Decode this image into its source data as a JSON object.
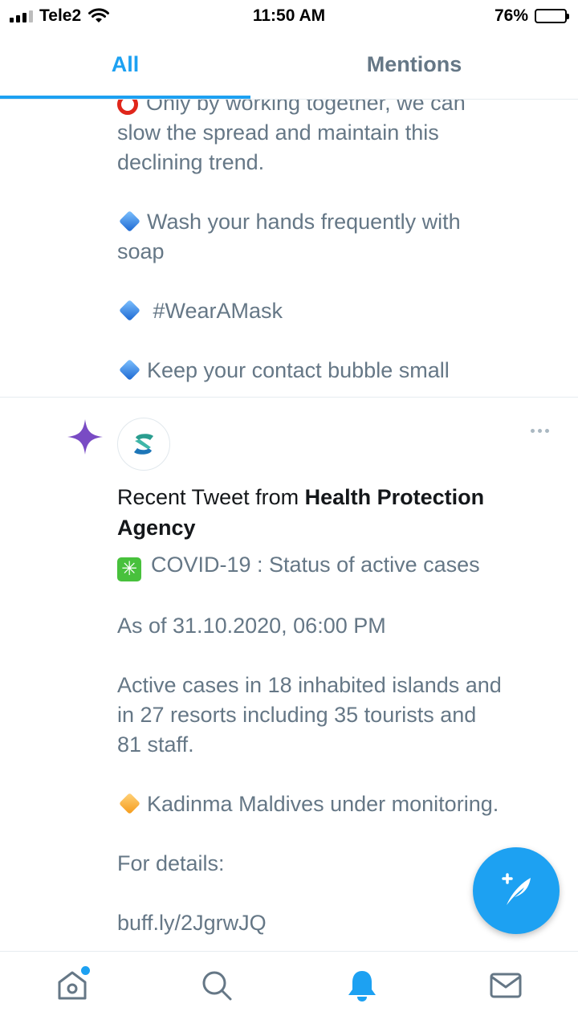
{
  "status_bar": {
    "carrier": "Tele2",
    "time": "11:50 AM",
    "battery_percent": "76%",
    "battery_level": 0.76,
    "icons": [
      "signal-icon",
      "wifi-icon",
      "battery-icon"
    ]
  },
  "tabs": [
    {
      "label": "All",
      "active": true
    },
    {
      "label": "Mentions",
      "active": false
    }
  ],
  "tweet_previous": {
    "lines": [
      {
        "icon": "red-circle-icon",
        "text": "Only by working together, we can"
      },
      {
        "text": "slow the spread and maintain this"
      },
      {
        "text": "declining trend."
      },
      {
        "text": ""
      },
      {
        "icon": "blue-diamond-icon",
        "text": "Wash your hands frequently with"
      },
      {
        "text": "soap"
      },
      {
        "text": ""
      },
      {
        "icon": "blue-diamond-icon",
        "text": " #WearAMask"
      },
      {
        "text": ""
      },
      {
        "icon": "blue-diamond-icon",
        "text": "Keep your contact bubble small"
      }
    ]
  },
  "recent_tweet": {
    "prefix": "Recent Tweet from ",
    "account": "Health Protection Agency",
    "lines": [
      {
        "icon": "green-check-icon",
        "text": "COVID-19 : Status of active cases"
      },
      {
        "text": ""
      },
      {
        "text": "As of 31.10.2020, 06:00 PM"
      },
      {
        "text": ""
      },
      {
        "text": "Active cases in 18 inhabited islands and"
      },
      {
        "text": "in 27 resorts including 35 tourists and"
      },
      {
        "text": "81 staff."
      },
      {
        "text": ""
      },
      {
        "icon": "orange-diamond-icon",
        "text": "Kadinma Maldives under monitoring."
      },
      {
        "text": ""
      },
      {
        "text": "For details:"
      },
      {
        "text": ""
      },
      {
        "text": "buff.ly/2JgrwJQ"
      }
    ]
  },
  "bottom_nav": {
    "items": [
      "home-icon",
      "search-icon",
      "notifications-bell-icon",
      "messages-icon"
    ],
    "active": "notifications-bell-icon"
  },
  "colors": {
    "accent": "#1da1f2",
    "body_text": "#657786",
    "sparkle": "#794bc4"
  }
}
